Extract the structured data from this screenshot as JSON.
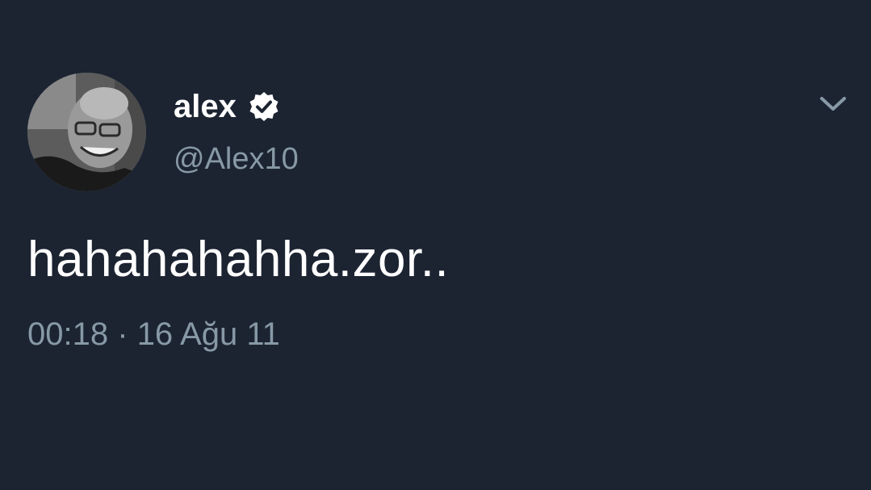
{
  "tweet": {
    "display_name": "alex",
    "handle": "@Alex10",
    "text": "hahahahahha.zor..",
    "time": "00:18",
    "separator": "·",
    "date": "16 Ağu 11",
    "verified": true
  },
  "icons": {
    "verified": "verified-badge-icon",
    "menu": "chevron-down-icon",
    "avatar": "profile-photo"
  },
  "colors": {
    "background": "#1c2432",
    "primary_text": "#ffffff",
    "secondary_text": "#8899a6"
  }
}
